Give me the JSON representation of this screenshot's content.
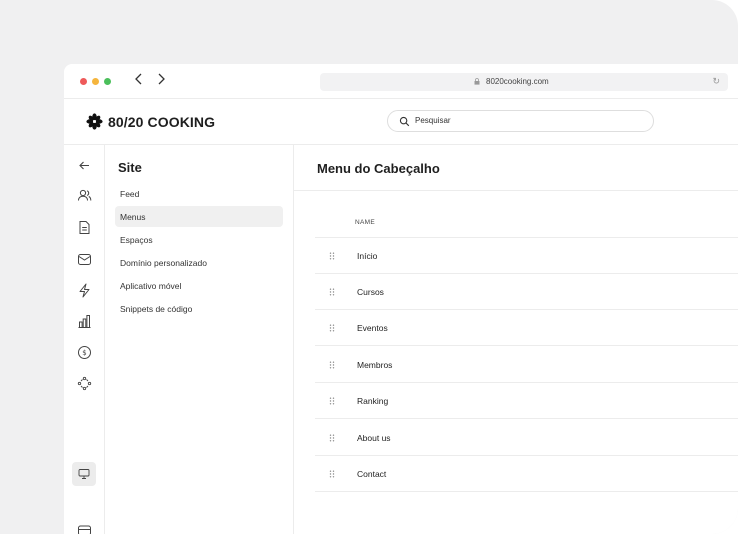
{
  "browser": {
    "url": "8020cooking.com",
    "back_icon": "chevron-left-icon",
    "forward_icon": "chevron-right-icon"
  },
  "header": {
    "brand": "80/20 COOKING",
    "search_placeholder": "Pesquisar"
  },
  "rail": {
    "icons": [
      "arrow-left-icon",
      "users-icon",
      "document-icon",
      "mail-icon",
      "bolt-icon",
      "chart-icon",
      "coin-icon",
      "integrations-icon",
      "monitor-icon",
      "card-icon",
      "gear-icon"
    ],
    "active": "monitor-icon"
  },
  "site": {
    "title": "Site",
    "items": [
      {
        "label": "Feed"
      },
      {
        "label": "Menus"
      },
      {
        "label": "Espaços"
      },
      {
        "label": "Domínio personalizado"
      },
      {
        "label": "Aplicativo móvel"
      },
      {
        "label": "Snippets de código"
      }
    ],
    "active_item": "Menus"
  },
  "main": {
    "title": "Menu do Cabeçalho",
    "column_header": "NAME",
    "rows": [
      {
        "name": "Início"
      },
      {
        "name": "Cursos"
      },
      {
        "name": "Eventos"
      },
      {
        "name": "Membros"
      },
      {
        "name": "Ranking"
      },
      {
        "name": "About us"
      },
      {
        "name": "Contact"
      }
    ]
  },
  "colors": {
    "red": "#ee5a5a",
    "yellow": "#f5b53d",
    "green": "#4bbf5b",
    "backdrop": "#f0f0f1",
    "active_bg": "#f0f0f0"
  }
}
